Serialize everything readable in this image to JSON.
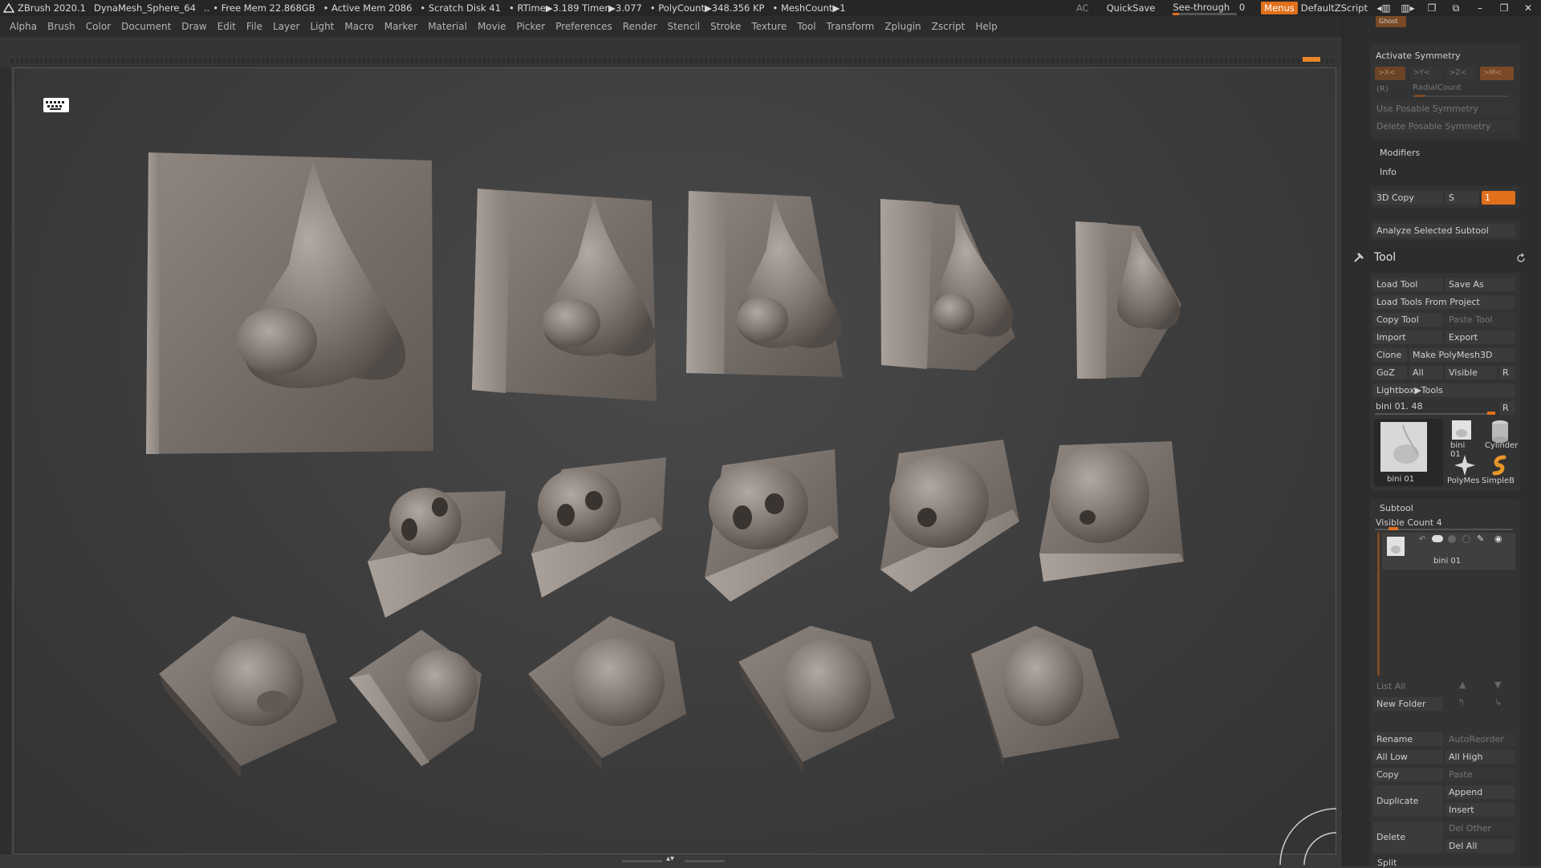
{
  "titlebar": {
    "app": "ZBrush 2020.1",
    "document": "DynaMesh_Sphere_64",
    "free_mem": "• Free Mem 22.868GB",
    "active_mem": "• Active Mem 2086",
    "scratch": "• Scratch Disk 41",
    "rtime": "• RTime▶3.189 Timer▶3.077",
    "polycount": "• PolyCount▶348.356 KP",
    "meshcount": "• MeshCount▶1",
    "ac": "AC",
    "quicksave": "QuickSave",
    "see_through": "See-through",
    "see_through_value": "0",
    "menus": "Menus",
    "script": "DefaultZScript"
  },
  "menubar": [
    "Alpha",
    "Brush",
    "Color",
    "Document",
    "Draw",
    "Edit",
    "File",
    "Layer",
    "Light",
    "Macro",
    "Marker",
    "Material",
    "Movie",
    "Picker",
    "Preferences",
    "Render",
    "Stencil",
    "Stroke",
    "Texture",
    "Tool",
    "Transform",
    "Zplugin",
    "Zscript",
    "Help"
  ],
  "symmetry": {
    "title": "Activate Symmetry",
    "x": ">X<",
    "y": ">Y<",
    "z": ">Z<",
    "m": ">M<",
    "r": "(R)",
    "radial": "RadialCount",
    "use_posable": "Use Posable Symmetry",
    "delete_posable": "Delete Posable Symmetry",
    "ghost": "Ghost"
  },
  "modifiers": "Modifiers",
  "info": "Info",
  "copy3d": {
    "label": "3D Copy",
    "s": "S",
    "value": "1"
  },
  "analyze": "Analyze Selected Subtool",
  "tool": {
    "title": "Tool",
    "load_tool": "Load Tool",
    "save_as": "Save As",
    "load_from_project": "Load Tools From Project",
    "copy_tool": "Copy Tool",
    "paste_tool": "Paste Tool",
    "import": "Import",
    "export": "Export",
    "clone": "Clone",
    "make_polymesh": "Make PolyMesh3D",
    "goz": "GoZ",
    "all": "All",
    "visible": "Visible",
    "r": "R",
    "lightbox": "Lightbox▶Tools",
    "current": "bini 01. 48",
    "current_r": "R",
    "thumbs": [
      "bini 01",
      "bini 01",
      "Cylinder",
      "PolyMes",
      "SimpleB"
    ]
  },
  "subtool": {
    "title": "Subtool",
    "visible_count": "Visible Count 4",
    "item": "bini 01",
    "list_all": "List All",
    "new_folder": "New Folder",
    "rename": "Rename",
    "autoreorder": "AutoReorder",
    "all_low": "All Low",
    "all_high": "All High",
    "copy": "Copy",
    "paste": "Paste",
    "append": "Append",
    "duplicate": "Duplicate",
    "insert": "Insert",
    "del_other": "Del Other",
    "delete": "Delete",
    "del_all": "Del All",
    "split": "Split"
  },
  "colors": {
    "accent": "#e0701c",
    "panel": "#2d2d2d",
    "canvas": "#3c3c3c"
  },
  "icons": [
    "zbrush-logo-icon",
    "keyboard-icon",
    "tool-hammer-icon",
    "refresh-icon",
    "rotate-gizmo-icon"
  ]
}
